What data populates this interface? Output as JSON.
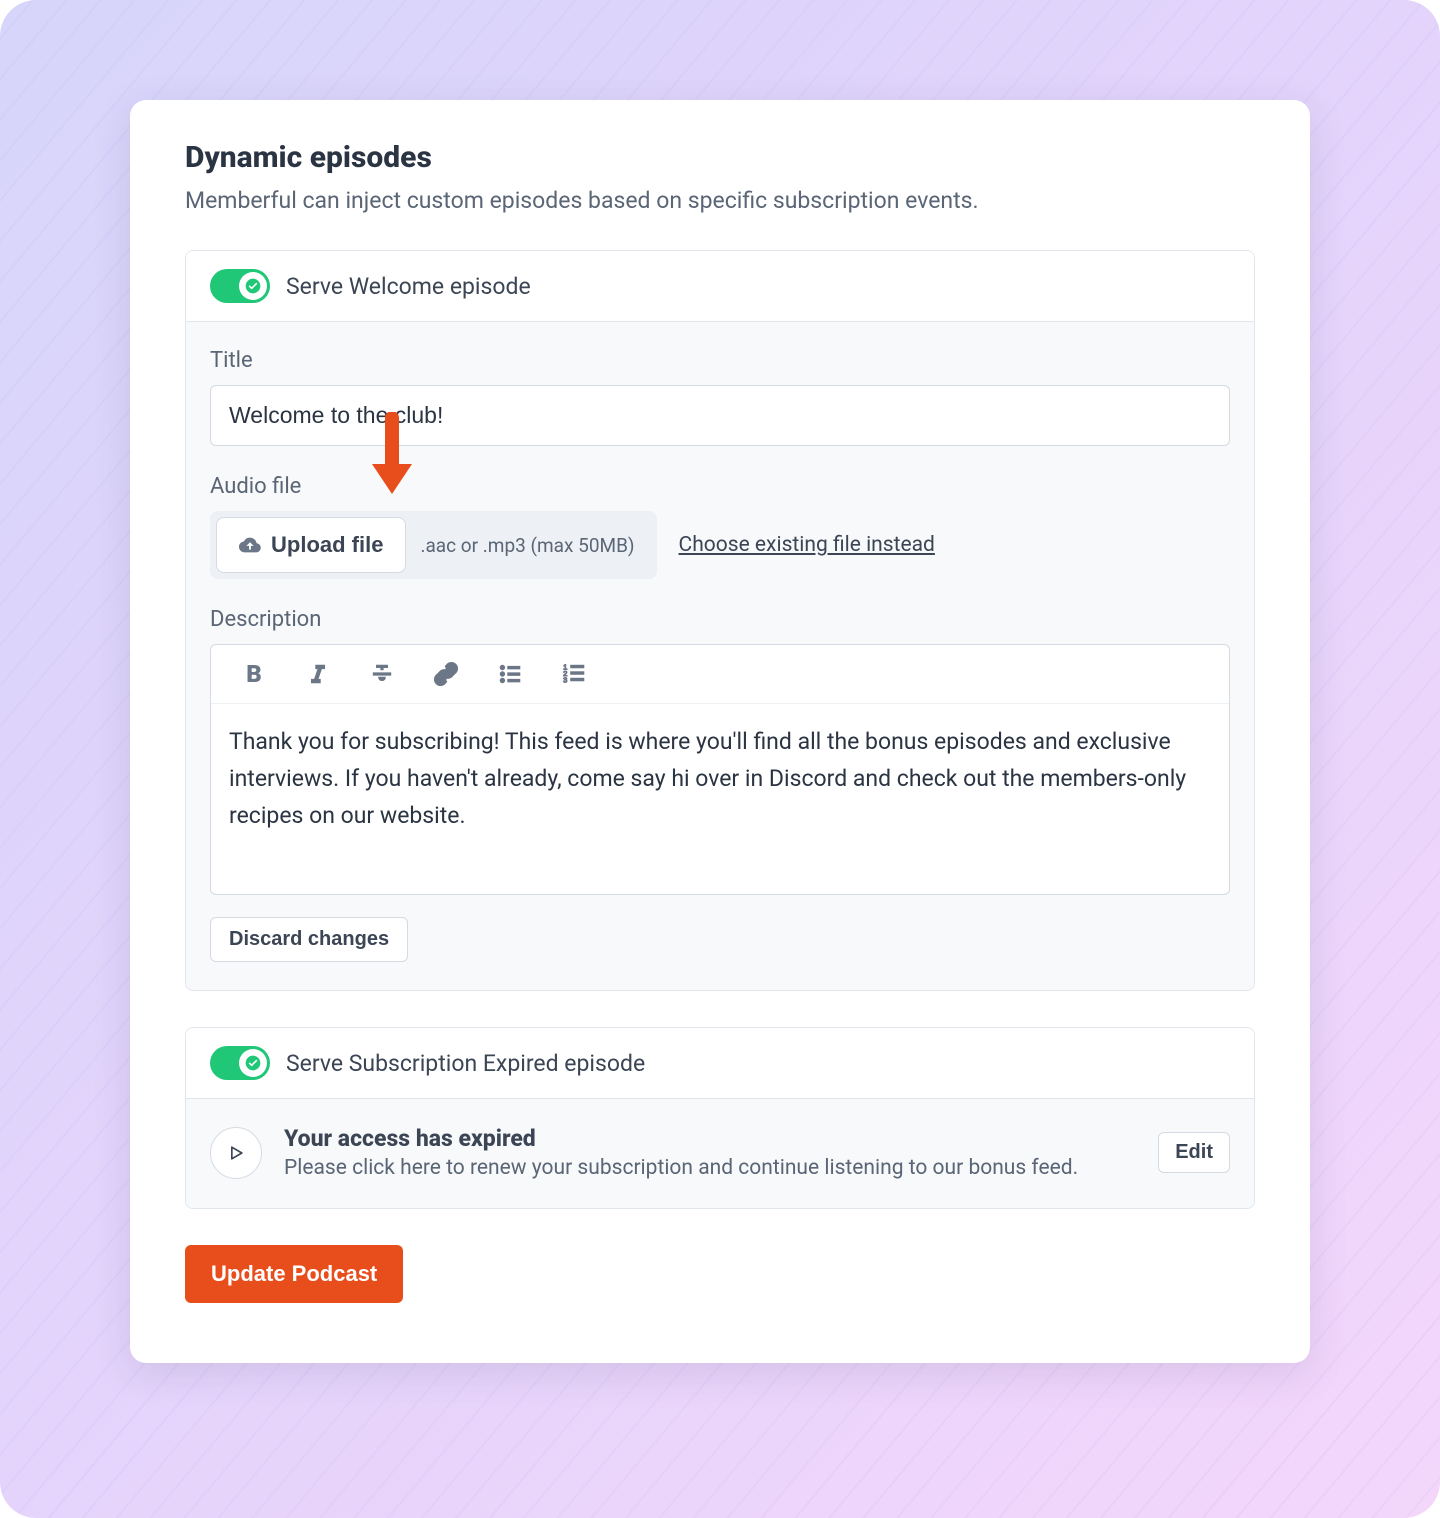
{
  "section": {
    "title": "Dynamic episodes",
    "subtitle": "Memberful can inject custom episodes based on specific subscription events."
  },
  "welcome": {
    "toggle_label": "Serve Welcome episode",
    "title_label": "Title",
    "title_value": "Welcome to the club!",
    "audio_label": "Audio file",
    "upload_label": "Upload file",
    "upload_hint": ".aac or .mp3 (max 50MB)",
    "choose_link": "Choose existing file instead",
    "description_label": "Description",
    "description_value": "Thank you for subscribing! This feed is where you'll find all the bonus episodes and exclusive interviews. If you haven't already, come say hi over in Discord and check out the members-only recipes on our website.",
    "discard_label": "Discard changes"
  },
  "expired": {
    "toggle_label": "Serve Subscription Expired episode",
    "title": "Your access has expired",
    "subtitle": "Please click here to renew your subscription and continue listening to our bonus feed.",
    "edit_label": "Edit"
  },
  "footer": {
    "update_label": "Update Podcast"
  }
}
